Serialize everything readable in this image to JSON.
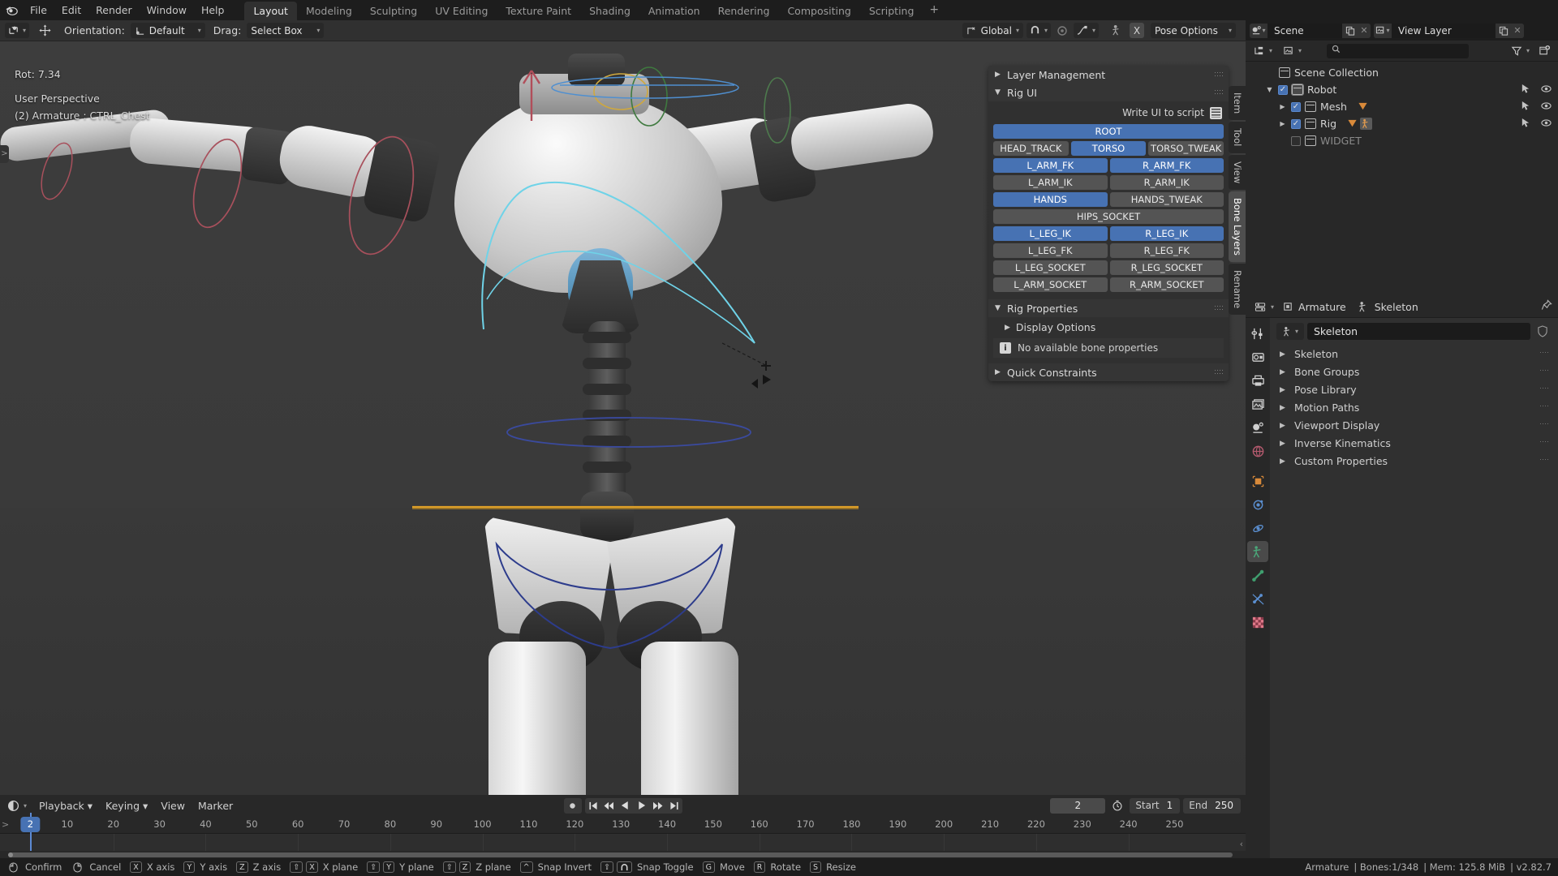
{
  "app": {
    "version": "v2.82.7",
    "accent": "#4772b3",
    "bg": "#303030"
  },
  "topbar": {
    "logo_icon": "blender-logo-icon",
    "menus": [
      "File",
      "Edit",
      "Render",
      "Window",
      "Help"
    ],
    "workspaces": [
      {
        "label": "Layout",
        "active": true
      },
      {
        "label": "Modeling",
        "active": false
      },
      {
        "label": "Sculpting",
        "active": false
      },
      {
        "label": "UV Editing",
        "active": false
      },
      {
        "label": "Texture Paint",
        "active": false
      },
      {
        "label": "Shading",
        "active": false
      },
      {
        "label": "Animation",
        "active": false
      },
      {
        "label": "Rendering",
        "active": false
      },
      {
        "label": "Compositing",
        "active": false
      },
      {
        "label": "Scripting",
        "active": false
      }
    ],
    "add_workspace": "+"
  },
  "viewport_header": {
    "editor_type_icon": "editor-type-icon",
    "transform_icon": "move-gizmo-icon",
    "orientation_label": "Orientation:",
    "orientation_value": "Default",
    "drag_label": "Drag:",
    "drag_value": "Select Box",
    "global_value": "Global",
    "snap_icon": "magnet-icon",
    "proportional_icon": "proportional-edit-icon",
    "proportional_falloff_icon": "falloff-curve-icon",
    "pose_toggle_icon": "pose-mode-icon",
    "pose_x_label": "X",
    "pose_options": "Pose Options"
  },
  "viewport_overlay": {
    "rotation": "Rot: 7.34",
    "perspective": "User Perspective",
    "object_info": "(2) Armature : CTRL_Chest"
  },
  "viewport_tabs": [
    {
      "label": "Item",
      "active": false
    },
    {
      "label": "Tool",
      "active": false
    },
    {
      "label": "View",
      "active": false
    },
    {
      "label": "Bone Layers",
      "active": true
    },
    {
      "label": "Rename",
      "active": false
    }
  ],
  "npanel": {
    "layer_management": {
      "title": "Layer Management",
      "expanded": false
    },
    "rig_ui": {
      "title": "Rig UI",
      "expanded": true,
      "write_ui_label": "Write UI to script",
      "write_ui_icon": "script-icon",
      "rows": [
        [
          {
            "label": "ROOT",
            "on": true
          }
        ],
        [
          {
            "label": "HEAD_TRACK",
            "on": false
          },
          {
            "label": "TORSO",
            "on": true
          },
          {
            "label": "TORSO_TWEAK",
            "on": false
          }
        ],
        [
          {
            "label": "L_ARM_FK",
            "on": true
          },
          {
            "label": "R_ARM_FK",
            "on": true
          }
        ],
        [
          {
            "label": "L_ARM_IK",
            "on": false
          },
          {
            "label": "R_ARM_IK",
            "on": false
          }
        ],
        [
          {
            "label": "HANDS",
            "on": true
          },
          {
            "label": "HANDS_TWEAK",
            "on": false
          }
        ],
        [
          {
            "label": "HIPS_SOCKET",
            "on": false
          }
        ],
        [
          {
            "label": "L_LEG_IK",
            "on": true
          },
          {
            "label": "R_LEG_IK",
            "on": true
          }
        ],
        [
          {
            "label": "L_LEG_FK",
            "on": false
          },
          {
            "label": "R_LEG_FK",
            "on": false
          }
        ],
        [
          {
            "label": "L_LEG_SOCKET",
            "on": false
          },
          {
            "label": "R_LEG_SOCKET",
            "on": false
          }
        ],
        [
          {
            "label": "L_ARM_SOCKET",
            "on": false
          },
          {
            "label": "R_ARM_SOCKET",
            "on": false
          }
        ]
      ]
    },
    "rig_properties": {
      "title": "Rig Properties",
      "expanded": true,
      "display_options": "Display Options",
      "no_bone_props": "No available bone properties",
      "info_icon": "info-icon"
    },
    "quick_constraints": {
      "title": "Quick Constraints",
      "expanded": false
    }
  },
  "outliner": {
    "scene_icon": "scene-icon",
    "scene_name": "Scene",
    "scene_copy_icon": "duplicate-icon",
    "scene_x_icon": "close-icon",
    "viewlayer_icon": "view-layer-icon",
    "viewlayer_name": "View Layer",
    "viewlayer_copy_icon": "duplicate-icon",
    "viewlayer_x_icon": "close-icon",
    "display_mode_icon": "outliner-display-mode-icon",
    "filter_id_icon": "view-layer-icon",
    "search_icon": "search-icon",
    "search_value": "",
    "search_placeholder": "",
    "filter_icon": "filter-funnel-icon",
    "new_collection_icon": "new-collection-icon",
    "tree": [
      {
        "label": "Scene Collection",
        "indent": 0,
        "disclosure": "none",
        "checkbox": "none",
        "icon": "collection-icon",
        "dim": false,
        "restrict": false
      },
      {
        "label": "Robot",
        "indent": 1,
        "disclosure": "open",
        "checkbox": "checked",
        "icon": "collection-icon",
        "dim": false,
        "restrict": true,
        "selected_icon": true
      },
      {
        "label": "Mesh",
        "indent": 2,
        "disclosure": "closed",
        "checkbox": "checked",
        "icon": "collection-icon",
        "dim": false,
        "restrict": true,
        "badges": [
          "modifier-triangle-icon"
        ]
      },
      {
        "label": "Rig",
        "indent": 2,
        "disclosure": "closed",
        "checkbox": "checked",
        "icon": "collection-icon",
        "dim": false,
        "restrict": true,
        "badges": [
          "modifier-triangle-icon",
          "armature-pose-icon"
        ]
      },
      {
        "label": "WIDGET",
        "indent": 2,
        "disclosure": "none",
        "checkbox": "unchecked",
        "icon": "collection-icon",
        "dim": true,
        "restrict": false
      }
    ],
    "restrict_cursor_icon": "cursor-select-icon",
    "restrict_eye_icon": "eye-icon"
  },
  "properties": {
    "editor_icon": "properties-editor-icon",
    "breadcrumb": [
      {
        "icon": "object-data-icon",
        "label": "Armature"
      },
      {
        "icon": "armature-data-icon",
        "label": "Skeleton"
      }
    ],
    "pin_icon": "pin-icon",
    "id_icon": "armature-data-icon",
    "id_name": "Skeleton",
    "shield_icon": "fake-user-shield-icon",
    "tabs": [
      {
        "name": "tool-icon",
        "active": false
      },
      {
        "name": "render-icon",
        "active": false
      },
      {
        "name": "output-printer-icon",
        "active": false
      },
      {
        "name": "view-layer-image-icon",
        "active": false
      },
      {
        "name": "scene-icon",
        "active": false
      },
      {
        "name": "world-icon",
        "active": false
      },
      {
        "name": "object-properties-icon",
        "active": false
      },
      {
        "name": "modifiers-wrench-icon",
        "active": false
      },
      {
        "name": "physics-icon",
        "active": false
      },
      {
        "name": "object-constraints-icon",
        "active": true
      },
      {
        "name": "bone-icon",
        "active": false
      },
      {
        "name": "bone-constraint-icon",
        "active": false
      },
      {
        "name": "material-checker-icon",
        "active": false
      }
    ],
    "panels": [
      "Skeleton",
      "Bone Groups",
      "Pose Library",
      "Motion Paths",
      "Viewport Display",
      "Inverse Kinematics",
      "Custom Properties"
    ]
  },
  "timeline": {
    "editor_icon": "timeline-editor-icon",
    "menus": [
      "Playback",
      "Keying",
      "View",
      "Marker"
    ],
    "record_icon": "auto-keying-record-icon",
    "transport": [
      "jump-to-start-icon",
      "prev-keyframe-icon",
      "play-reverse-icon",
      "play-icon",
      "next-keyframe-icon",
      "jump-to-end-icon"
    ],
    "current_frame": "2",
    "clock_icon": "use-preview-range-icon",
    "start_label": "Start",
    "start_value": "1",
    "end_label": "End",
    "end_value": "250",
    "ruler_ticks": [
      10,
      20,
      30,
      40,
      50,
      60,
      70,
      80,
      90,
      100,
      110,
      120,
      130,
      140,
      150,
      160,
      170,
      180,
      190,
      200,
      210,
      220,
      230,
      240,
      250
    ],
    "playhead_frame": 2,
    "range_min": 0,
    "range_max": 258
  },
  "statusbar": {
    "shortcuts": [
      {
        "keys": [
          "mouse-left-icon"
        ],
        "label": "Confirm"
      },
      {
        "keys": [
          "mouse-right-icon"
        ],
        "label": "Cancel"
      },
      {
        "keys": [
          "X"
        ],
        "label": "X axis"
      },
      {
        "keys": [
          "Y"
        ],
        "label": "Y axis"
      },
      {
        "keys": [
          "Z"
        ],
        "label": "Z axis"
      },
      {
        "keys": [
          "⇧",
          "X"
        ],
        "label": "X plane"
      },
      {
        "keys": [
          "⇧",
          "Y"
        ],
        "label": "Y plane"
      },
      {
        "keys": [
          "⇧",
          "Z"
        ],
        "label": "Z plane"
      },
      {
        "keys": [
          "^"
        ],
        "label": "Snap Invert"
      },
      {
        "keys": [
          "⇧",
          "magnet-icon"
        ],
        "label": "Snap Toggle"
      },
      {
        "keys": [
          "G"
        ],
        "label": "Move"
      },
      {
        "keys": [
          "R"
        ],
        "label": "Rotate"
      },
      {
        "keys": [
          "S"
        ],
        "label": "Resize"
      }
    ],
    "info": [
      "Armature",
      "Bones:1/348",
      "Mem: 125.8 MiB",
      "v2.82.7"
    ]
  }
}
